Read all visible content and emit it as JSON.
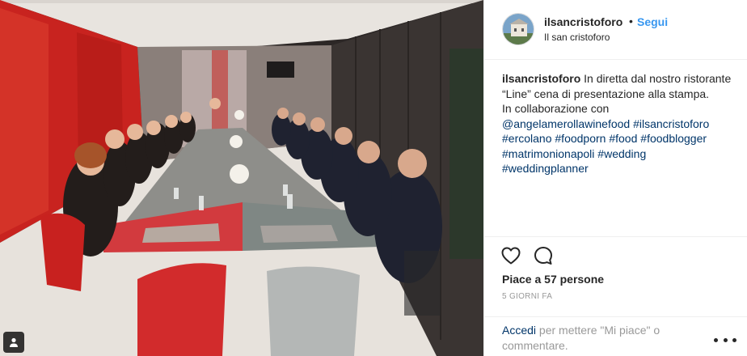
{
  "post": {
    "username": "ilsancristoforo",
    "separator": "•",
    "follow_label": "Segui",
    "location": "Il san cristoforo"
  },
  "caption": {
    "username": "ilsancristoforo",
    "line1": "In diretta dal nostro ristorante “Line” cena di presentazione alla stampa.",
    "line2": "In collaborazione con",
    "mentions": [
      "@angelamerollawinefood"
    ],
    "hashtags": [
      "#ilsancristoforo",
      "#ercolano",
      "#foodporn",
      "#food",
      "#foodblogger",
      "#matrimonionapoli",
      "#wedding",
      "#weddingplanner"
    ]
  },
  "actions": {
    "likes_text": "Piace a 57 persone",
    "time_text": "5 GIORNI FA"
  },
  "comment": {
    "login_link": "Accedi",
    "prompt": " per mettere \"Mi piace\" o commentare."
  },
  "icons": {
    "like": "heart-outline-icon",
    "comment": "comment-bubble-icon",
    "more": "more-options-icon",
    "tagged": "person-tag-icon"
  },
  "colors": {
    "follow": "#3897f0",
    "link": "#003569",
    "muted": "#999999"
  }
}
